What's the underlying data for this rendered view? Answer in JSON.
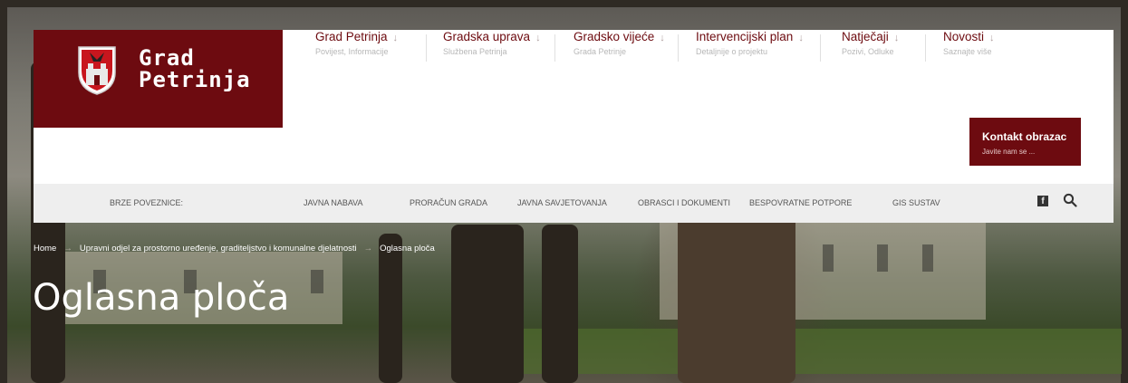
{
  "brand": {
    "name_line1": "Grad",
    "name_line2": "Petrinja",
    "brand_color": "#6d0b10"
  },
  "nav": [
    {
      "title": "Grad Petrinja",
      "subtitle": "Povijest, Informacije"
    },
    {
      "title": "Gradska uprava",
      "subtitle": "Službena Petrinja"
    },
    {
      "title": "Gradsko vijeće",
      "subtitle": "Grada Petrinje"
    },
    {
      "title": "Intervencijski plan",
      "subtitle": "Detaljnije o projektu"
    },
    {
      "title": "Natječaji",
      "subtitle": "Pozivi, Odluke"
    },
    {
      "title": "Novosti",
      "subtitle": "Saznajte više"
    }
  ],
  "nav_arrow": "↓",
  "contact": {
    "title": "Kontakt obrazac",
    "subtitle": "Javite nam se ..."
  },
  "quick_links": {
    "label": "BRZE POVEZNICE:",
    "items": [
      "JAVNA NABAVA",
      "PRORAČUN GRADA",
      "JAVNA SAVJETOVANJA",
      "OBRASCI I DOKUMENTI",
      "BESPOVRATNE POTPORE",
      "GIS SUSTAV"
    ],
    "facebook_icon": "f"
  },
  "breadcrumb": [
    "Home",
    "Upravni odjel za prostorno uređenje, graditeljstvo i komunalne djelatnosti",
    "Oglasna ploča"
  ],
  "breadcrumb_sep": "→",
  "page_title": "Oglasna ploča"
}
